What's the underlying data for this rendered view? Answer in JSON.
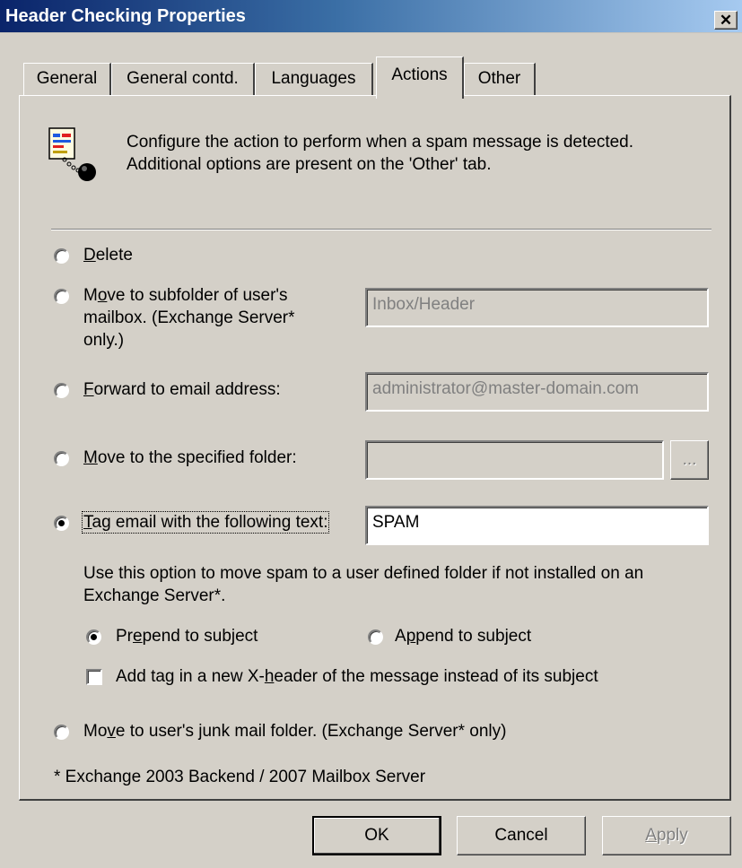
{
  "window": {
    "title": "Header Checking Properties",
    "close_glyph": "✕"
  },
  "tabs": [
    {
      "label": "General"
    },
    {
      "label": "General contd."
    },
    {
      "label": "Languages"
    },
    {
      "label": "Actions",
      "selected": true
    },
    {
      "label": "Other"
    }
  ],
  "intro": {
    "icon": "spam-ball-and-chain-icon",
    "line1": "Configure the action to perform when a spam message is detected.",
    "line2": "Additional options are present on the 'Other' tab."
  },
  "options": {
    "delete": {
      "label_rest": "elete",
      "mnemonic": "D",
      "selected": false
    },
    "move_subfolder": {
      "line1_pre": "M",
      "line1_mnemonic": "o",
      "line1_post": "ve to subfolder of user's",
      "line2": "mailbox. (Exchange Server*",
      "line3": "only.)",
      "value": "Inbox/Header",
      "selected": false
    },
    "forward": {
      "mnemonic": "F",
      "label_rest": "orward to email address:",
      "value": "administrator@master-domain.com",
      "selected": false
    },
    "move_folder": {
      "mnemonic": "M",
      "label_rest": "ove to the specified folder:",
      "value": "",
      "browse_label": "...",
      "selected": false
    },
    "tag": {
      "mnemonic": "T",
      "label_rest": "ag email with the following text:",
      "value": "SPAM",
      "selected": true
    },
    "junk": {
      "pre": "Mo",
      "mnemonic": "v",
      "post": "e to user's junk mail folder. (Exchange Server* only)",
      "selected": false
    }
  },
  "tag_help": {
    "line1": "Use this option to move spam to a user defined folder if not installed on an",
    "line2": "Exchange Server*."
  },
  "tag_position": {
    "prepend": {
      "pre": "Pr",
      "mnemonic": "e",
      "post": "pend to subject",
      "selected": true
    },
    "append": {
      "pre": "A",
      "mnemonic": "p",
      "post": "pend to subject",
      "selected": false
    }
  },
  "xheader": {
    "pre": "Add tag in a new X-",
    "mnemonic": "h",
    "post": "eader of the message instead of its subject",
    "checked": false
  },
  "footnote": "* Exchange 2003 Backend / 2007 Mailbox Server",
  "buttons": {
    "ok": "OK",
    "cancel": "Cancel",
    "apply_mnemonic": "A",
    "apply_rest": "pply"
  }
}
